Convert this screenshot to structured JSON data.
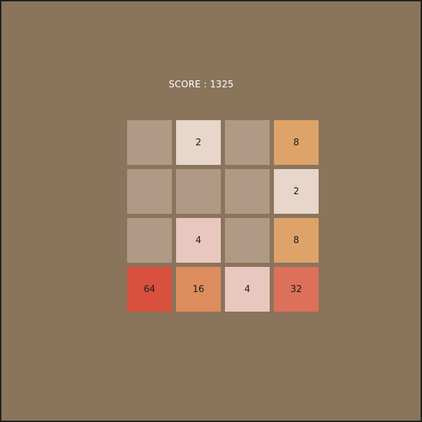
{
  "score_text": "SCORE : 1325",
  "empty_color": "#b09a86",
  "tile_colors": {
    "2": "#e8d6ca",
    "4": "#e8c8be",
    "8": "#dea368",
    "16": "#dd8c5e",
    "32": "#dc705a",
    "64": "#d9513e"
  },
  "board": [
    [
      null,
      2,
      null,
      8
    ],
    [
      null,
      null,
      null,
      2
    ],
    [
      null,
      4,
      null,
      8
    ],
    [
      64,
      16,
      4,
      32
    ]
  ]
}
